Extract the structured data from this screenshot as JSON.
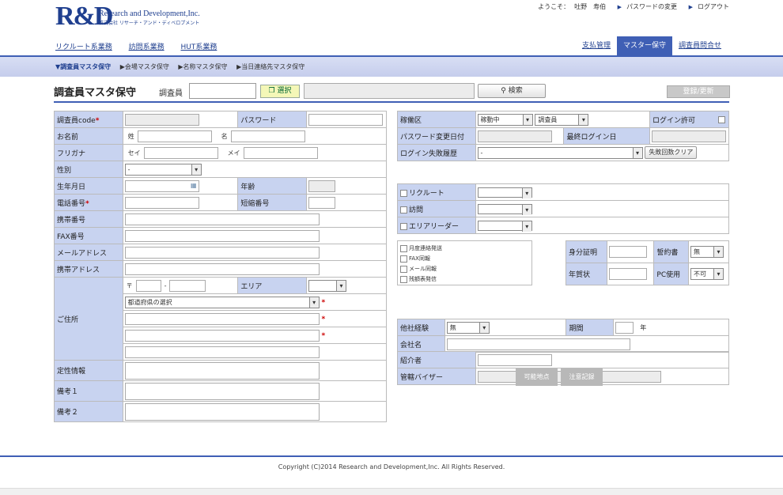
{
  "header": {
    "logo": "R&D",
    "company_en": "Research and Development,Inc.",
    "company_jp": "株式会社 リサーチ・アンド・ディベロプメント",
    "welcome": "ようこそ：",
    "user_name": "吐野　寿伯",
    "change_password": "パスワードの変更",
    "logout": "ログアウト"
  },
  "nav": {
    "left": [
      "リクルート系業務",
      "訪問系業務",
      "HUT系業務"
    ],
    "right": [
      "支払管理",
      "マスター保守",
      "調査員問合せ"
    ]
  },
  "subnav": [
    "▼調査員マスタ保守",
    "▶会場マスタ保守",
    "▶名称マスタ保守",
    "▶当日連絡先マスタ保守"
  ],
  "titlebar": {
    "title": "調査員マスタ保守",
    "label": "調査員",
    "select_btn": "選択",
    "search_btn": "検索",
    "register_btn": "登録/更新"
  },
  "left": {
    "code": "調査員code",
    "password": "パスワード",
    "name": "お名前",
    "sei": "姓",
    "mei": "名",
    "furigana": "フリガナ",
    "sei_kana": "セイ",
    "mei_kana": "メイ",
    "gender": "性別",
    "gender_val": "-",
    "birth": "生年月日",
    "age": "年齢",
    "phone": "電話番号",
    "short_number": "短縮番号",
    "mobile": "携帯番号",
    "fax": "FAX番号",
    "mail": "メールアドレス",
    "mobile_addr": "携帯アドレス",
    "address": "ご住所",
    "postal_mark": "〒",
    "postal_sep": "-",
    "area": "エリア",
    "prefecture": "都道府県の選択",
    "qualitative": "定性情報",
    "note1": "備考１",
    "note2": "備考２"
  },
  "right": {
    "status": "稼働区",
    "status_val": "稼動中",
    "type_val": "調査員",
    "login_allowed": "ログイン許可",
    "pw_changed": "パスワード変更日付",
    "last_login": "最終ログイン日",
    "login_fail": "ログイン失敗履歴",
    "login_fail_val": "-",
    "clear_btn": "失敗回数クリア",
    "recruit": "リクルート",
    "visit": "訪問",
    "area_leader": "エリアリーダー",
    "checks": [
      "月度連絡発送",
      "FAX同報",
      "メール同報",
      "残額表発信"
    ],
    "id_proof": "身分証明",
    "pledge": "誓約書",
    "pledge_val": "無",
    "new_year_card": "年賀状",
    "pc_use": "PC使用",
    "pc_val": "不可",
    "other_exp": "他社経験",
    "other_exp_val": "無",
    "period": "期間",
    "year_unit": "年",
    "company_name": "会社名",
    "referrer": "紹介者",
    "supervisor": "管轄バイザー",
    "overlay1": "可能地点",
    "overlay2": "注意記録"
  },
  "footer": {
    "copyright": "Copyright (C)2014 Research and Development,Inc. All Rights Reserved."
  }
}
